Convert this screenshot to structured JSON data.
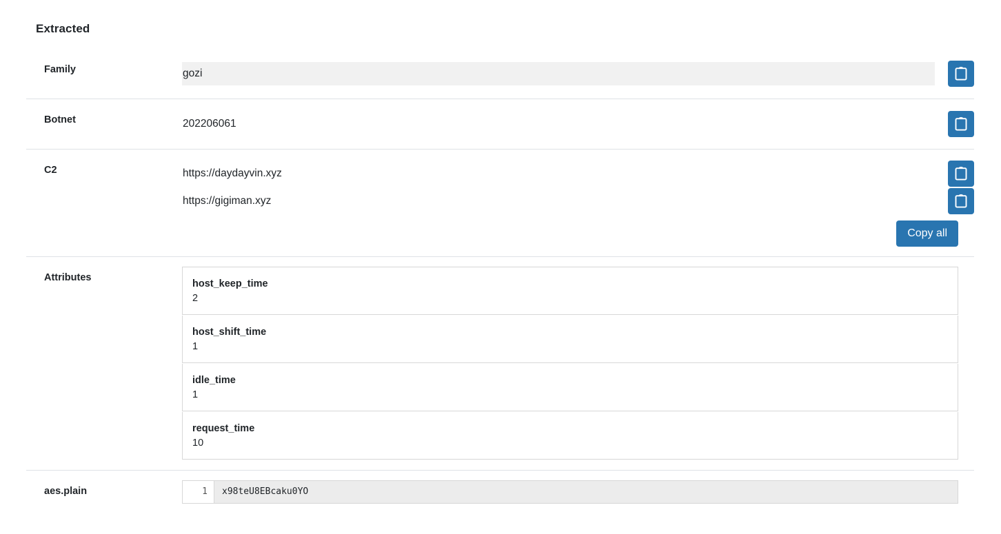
{
  "section": {
    "title": "Extracted"
  },
  "rows": {
    "family": {
      "label": "Family",
      "value": "gozi",
      "copy_icon": "clipboard-icon"
    },
    "botnet": {
      "label": "Botnet",
      "value": "202206061",
      "copy_icon": "clipboard-icon"
    },
    "c2": {
      "label": "C2",
      "values": [
        "https://daydayvin.xyz",
        "https://gigiman.xyz"
      ],
      "copy_icon": "clipboard-icon",
      "copy_all_label": "Copy all"
    },
    "attributes": {
      "label": "Attributes",
      "items": [
        {
          "key": "host_keep_time",
          "value": "2"
        },
        {
          "key": "host_shift_time",
          "value": "1"
        },
        {
          "key": "idle_time",
          "value": "1"
        },
        {
          "key": "request_time",
          "value": "10"
        }
      ]
    },
    "aes_plain": {
      "label": "aes.plain",
      "line_number": "1",
      "content": "x98teU8EBcaku0YO"
    }
  },
  "colors": {
    "accent": "#2975b0",
    "divider": "#dee2e6",
    "card_border": "#d7d7d7",
    "highlight_bg": "#f1f1f1",
    "code_bg": "#ececec",
    "text": "#212529"
  }
}
